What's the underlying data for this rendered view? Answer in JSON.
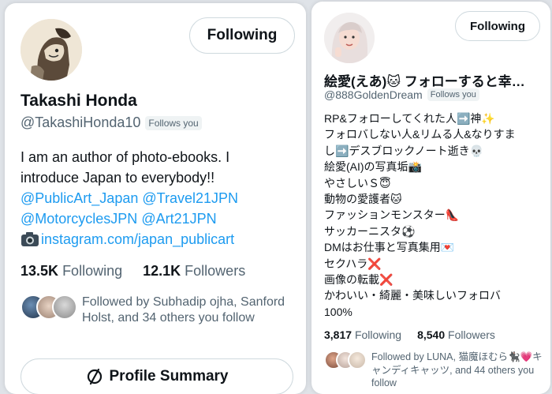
{
  "card1": {
    "follow_button": "Following",
    "display_name": "Takashi Honda",
    "handle": "@TakashiHonda10",
    "follows_you": "Follows you",
    "bio_line1": "I am an author of photo-ebooks. I",
    "bio_line2": "introduce Japan to everybody!!",
    "link1": "@PublicArt_Japan",
    "link2": "@Travel21JPN",
    "link3": "@MotorcyclesJPN",
    "link4": "@Art21JPN",
    "link5": "instagram.com/japan_publicart",
    "following_count": "13.5K",
    "following_label": "Following",
    "followers_count": "12.1K",
    "followers_label": "Followers",
    "followed_by": "Followed by Subhadip ojha, Sanford Holst, and 34 others you follow",
    "profile_summary": "Profile Summary"
  },
  "card2": {
    "follow_button": "Following",
    "display_name": "絵愛(えあ)🐱 フォローすると幸…",
    "handle": "@888GoldenDream",
    "follows_you": "Follows you",
    "bio_lines": [
      "RP&フォローしてくれた人➡️神✨",
      "フォロバしない人&リムる人&なりすま",
      "し➡️デスブロックノート逝き💀",
      "絵愛(AI)の写真垢📸",
      "やさしいＳ😇",
      "動物の愛護者🐱",
      "ファッションモンスター👠",
      "サッカーニスタ⚽",
      "DMはお仕事と写真集用💌",
      "セクハラ❌",
      "画像の転載❌",
      "かわいい・綺麗・美味しいフォロバ",
      "100%"
    ],
    "following_count": "3,817",
    "following_label": "Following",
    "followers_count": "8,540",
    "followers_label": "Followers",
    "followed_by": "Followed by LUNA, 猫魔ほむら🐈‍⬛💗キャンディキャッツ, and 44 others you follow"
  }
}
